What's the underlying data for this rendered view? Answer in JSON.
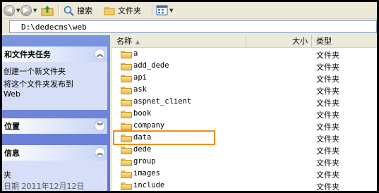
{
  "toolbar": {
    "search_label": "搜索",
    "folders_label": "文件夹"
  },
  "address": {
    "path": "D:\\dedecms\\web"
  },
  "left_panel": {
    "tasks_title": "和文件夹任务",
    "tasks": [
      "创建一个新文件夹",
      "将这个文件夹发布到",
      "Web"
    ],
    "places_title": "位置",
    "details_title": "信息",
    "details_lines": [
      "夹",
      "日期 2011年12月12日"
    ]
  },
  "columns": {
    "name": "名称",
    "size": "大小",
    "type": "类型"
  },
  "files": [
    {
      "name": "a",
      "type": "文件夹"
    },
    {
      "name": "add_dede",
      "type": "文件夹"
    },
    {
      "name": "api",
      "type": "文件夹"
    },
    {
      "name": "ask",
      "type": "文件夹"
    },
    {
      "name": "aspnet_client",
      "type": "文件夹"
    },
    {
      "name": "book",
      "type": "文件夹"
    },
    {
      "name": "company",
      "type": "文件夹"
    },
    {
      "name": "data",
      "type": "文件夹",
      "highlighted": true
    },
    {
      "name": "dede",
      "type": "文件夹"
    },
    {
      "name": "group",
      "type": "文件夹"
    },
    {
      "name": "images",
      "type": "文件夹"
    },
    {
      "name": "include",
      "type": "文件夹"
    }
  ],
  "colors": {
    "highlight_border": "#f28c1a",
    "panel_bg": "#d6dff7",
    "pane_gradient_top": "#7a96df"
  }
}
